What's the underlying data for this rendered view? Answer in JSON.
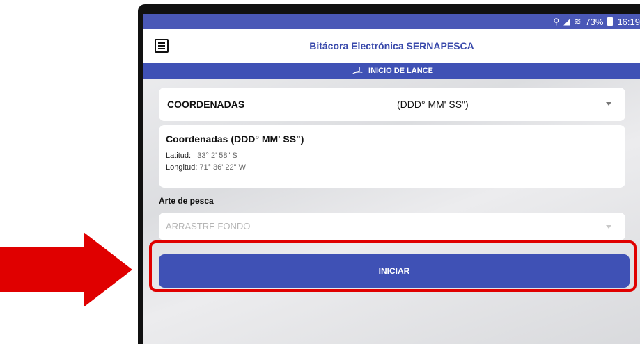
{
  "status_bar": {
    "icons": [
      "location-icon",
      "signal-icon",
      "wifi-icon",
      "battery-icon"
    ],
    "battery": "73%",
    "time": "16:19"
  },
  "app": {
    "title": "Bitácora Electrónica SERNAPESCA",
    "section": "INICIO DE LANCE"
  },
  "coordinates_select": {
    "label": "COORDENADAS",
    "value": "(DDD° MM' SS\")"
  },
  "coordinates_card": {
    "title": "Coordenadas (DDD° MM' SS\")",
    "lat_label": "Latitud:",
    "lat_value": "33° 2' 58\" S",
    "lon_label": "Longitud:",
    "lon_value": "71° 36' 22\" W"
  },
  "arte": {
    "label": "Arte de pesca",
    "placeholder": "ARRASTRE FONDO"
  },
  "action": {
    "label": "INICIAR"
  },
  "colors": {
    "primary": "#3f51b5",
    "highlight": "#e00000",
    "arrow": "#e00000"
  }
}
